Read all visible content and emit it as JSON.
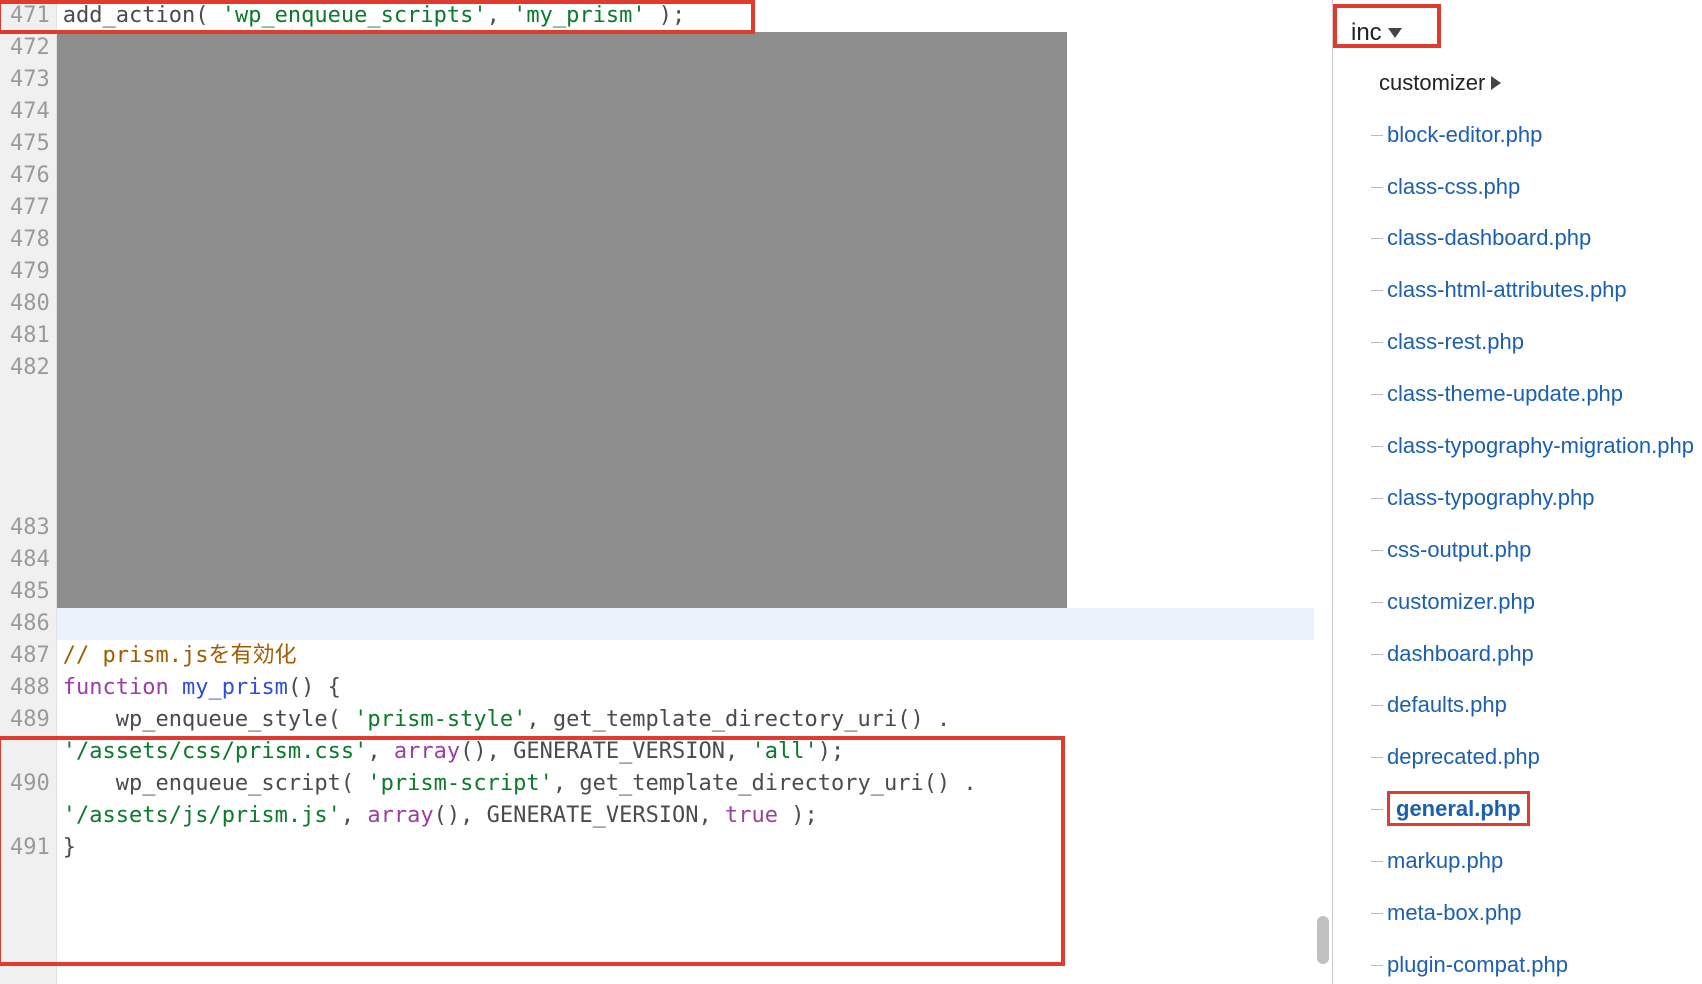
{
  "editor": {
    "line_numbers": [
      "471",
      "472",
      "473",
      "474",
      "475",
      "476",
      "477",
      "478",
      "479",
      "480",
      "481",
      "482",
      "483",
      "484",
      "485",
      "486",
      "487",
      "488",
      "489",
      "490",
      "491"
    ],
    "lines": {
      "471": {
        "segments": [
          {
            "t": "add_action",
            "c": "fn"
          },
          {
            "t": "( ",
            "c": "punct"
          },
          {
            "t": "'wp_enqueue_scripts'",
            "c": "str"
          },
          {
            "t": ", ",
            "c": "punct"
          },
          {
            "t": "'my_prism'",
            "c": "str"
          },
          {
            "t": " );",
            "c": "punct"
          }
        ]
      },
      "487": {
        "segments": [
          {
            "t": "// prism.jsを有効化",
            "c": "cmt"
          }
        ]
      },
      "488": {
        "segments": [
          {
            "t": "function ",
            "c": "kw"
          },
          {
            "t": "my_prism",
            "c": "def"
          },
          {
            "t": "() {",
            "c": "punct"
          }
        ]
      },
      "489": {
        "segments": [
          {
            "t": "    wp_enqueue_style( ",
            "c": "fn"
          },
          {
            "t": "'prism-style'",
            "c": "str"
          },
          {
            "t": ", get_template_directory_uri() . ",
            "c": "fn"
          }
        ]
      },
      "489b": {
        "segments": [
          {
            "t": "'/assets/css/prism.css'",
            "c": "str"
          },
          {
            "t": ", ",
            "c": "punct"
          },
          {
            "t": "array",
            "c": "kw"
          },
          {
            "t": "(), GENERATE_VERSION, ",
            "c": "fn"
          },
          {
            "t": "'all'",
            "c": "str"
          },
          {
            "t": ");",
            "c": "punct"
          }
        ]
      },
      "490": {
        "segments": [
          {
            "t": "    wp_enqueue_script( ",
            "c": "fn"
          },
          {
            "t": "'prism-script'",
            "c": "str"
          },
          {
            "t": ", get_template_directory_uri() . ",
            "c": "fn"
          }
        ]
      },
      "490b": {
        "segments": [
          {
            "t": "'/assets/js/prism.js'",
            "c": "str"
          },
          {
            "t": ", ",
            "c": "punct"
          },
          {
            "t": "array",
            "c": "kw"
          },
          {
            "t": "(), GENERATE_VERSION, ",
            "c": "fn"
          },
          {
            "t": "true",
            "c": "kw"
          },
          {
            "t": " );",
            "c": "punct"
          }
        ]
      },
      "491": {
        "segments": [
          {
            "t": "}",
            "c": "punct"
          }
        ]
      }
    }
  },
  "sidebar": {
    "root": "inc",
    "folder": "customizer",
    "files": [
      "block-editor.php",
      "class-css.php",
      "class-dashboard.php",
      "class-html-attributes.php",
      "class-rest.php",
      "class-theme-update.php",
      "class-typography-migration.php",
      "class-typography.php",
      "css-output.php",
      "customizer.php",
      "dashboard.php",
      "defaults.php",
      "deprecated.php",
      "general.php",
      "markup.php",
      "meta-box.php",
      "plugin-compat.php"
    ],
    "selected": "general.php"
  }
}
